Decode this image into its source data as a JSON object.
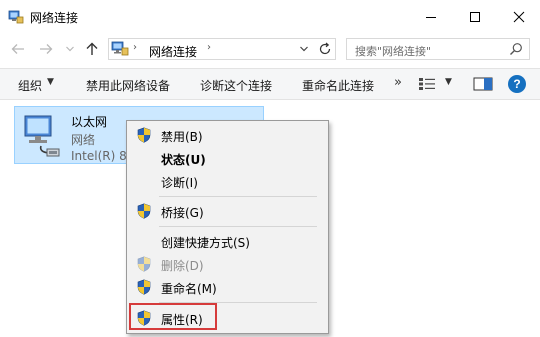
{
  "window": {
    "title": "网络连接"
  },
  "address": {
    "path": "网络连接",
    "separator": "›"
  },
  "search": {
    "placeholder": "搜索\"网络连接\""
  },
  "commands": {
    "organize": "组织",
    "disable_device": "禁用此网络设备",
    "diagnose": "诊断这个连接",
    "rename": "重命名此连接",
    "more": "»"
  },
  "help": {
    "label": "?"
  },
  "item": {
    "name": "以太网",
    "status": "网络",
    "device": "Intel(R) 82"
  },
  "context_menu": {
    "disable": "禁用(B)",
    "status": "状态(U)",
    "diagnose": "诊断(I)",
    "bridge": "桥接(G)",
    "shortcut": "创建快捷方式(S)",
    "delete": "删除(D)",
    "rename": "重命名(M)",
    "properties": "属性(R)"
  },
  "colors": {
    "selection": "#cce8ff",
    "highlight_border": "#d63b3b",
    "accent": "#1570c0"
  },
  "icons": [
    "network-connections-icon",
    "minimize-icon",
    "maximize-icon",
    "close-icon",
    "back-arrow-icon",
    "forward-arrow-icon",
    "recent-dropdown-icon",
    "up-arrow-icon",
    "computer-icon",
    "refresh-icon",
    "search-icon",
    "view-options-icon",
    "preview-pane-icon",
    "help-icon",
    "ethernet-adapter-icon",
    "uac-shield-icon"
  ]
}
